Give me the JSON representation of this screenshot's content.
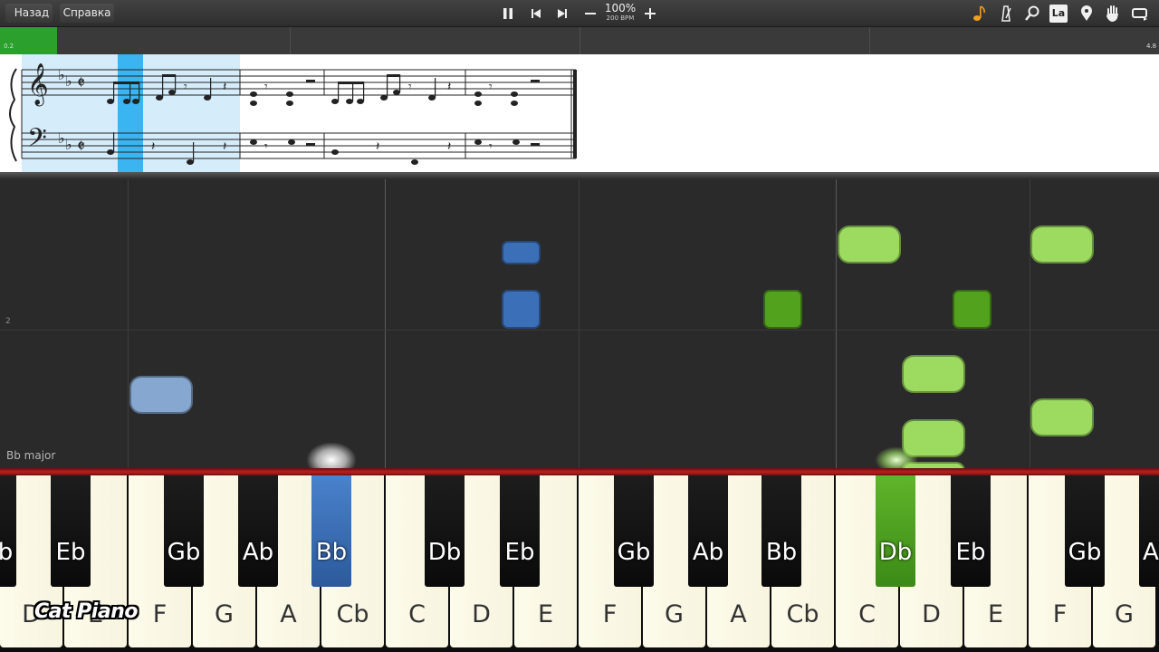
{
  "toolbar": {
    "back_label": "Назад",
    "help_label": "Справка",
    "zoom_percent": "100%",
    "tempo_bpm": "200 BPM",
    "icons": [
      "pause-icon",
      "skip-back-icon",
      "skip-forward-icon",
      "minus-icon",
      "plus-icon",
      "note-color-icon",
      "metronome-icon",
      "magnifier-icon",
      "note-labels-icon",
      "location-pin-icon",
      "hand-icon",
      "loop-icon"
    ],
    "note_labels_glyph": "La"
  },
  "progress": {
    "start_label": "0.2",
    "end_label": "4.8",
    "fraction": 0.049,
    "fill_color": "#2ca02c"
  },
  "roll": {
    "key_signature_label": "Bb major",
    "measure_number": "2",
    "colors": {
      "light_green": "#9cdb5f",
      "dark_green": "#53a21e",
      "blue": "#3b70b8",
      "light_blue": "#86a7cf"
    }
  },
  "keyboard": {
    "white_keys": [
      "D",
      "E",
      "F",
      "G",
      "A",
      "Cb",
      "C",
      "D",
      "E",
      "F",
      "G",
      "A",
      "Cb",
      "C",
      "D",
      "E",
      "F",
      "G"
    ],
    "black_keys": [
      "Db",
      "Eb",
      "Gb",
      "Ab",
      "Bb",
      "Db",
      "Eb",
      "Gb",
      "Ab",
      "Bb",
      "Db",
      "Eb",
      "Gb",
      "Ab"
    ],
    "active_blue_key": "Bb",
    "active_green_key": "Db"
  },
  "watermark": "Cat Piano"
}
